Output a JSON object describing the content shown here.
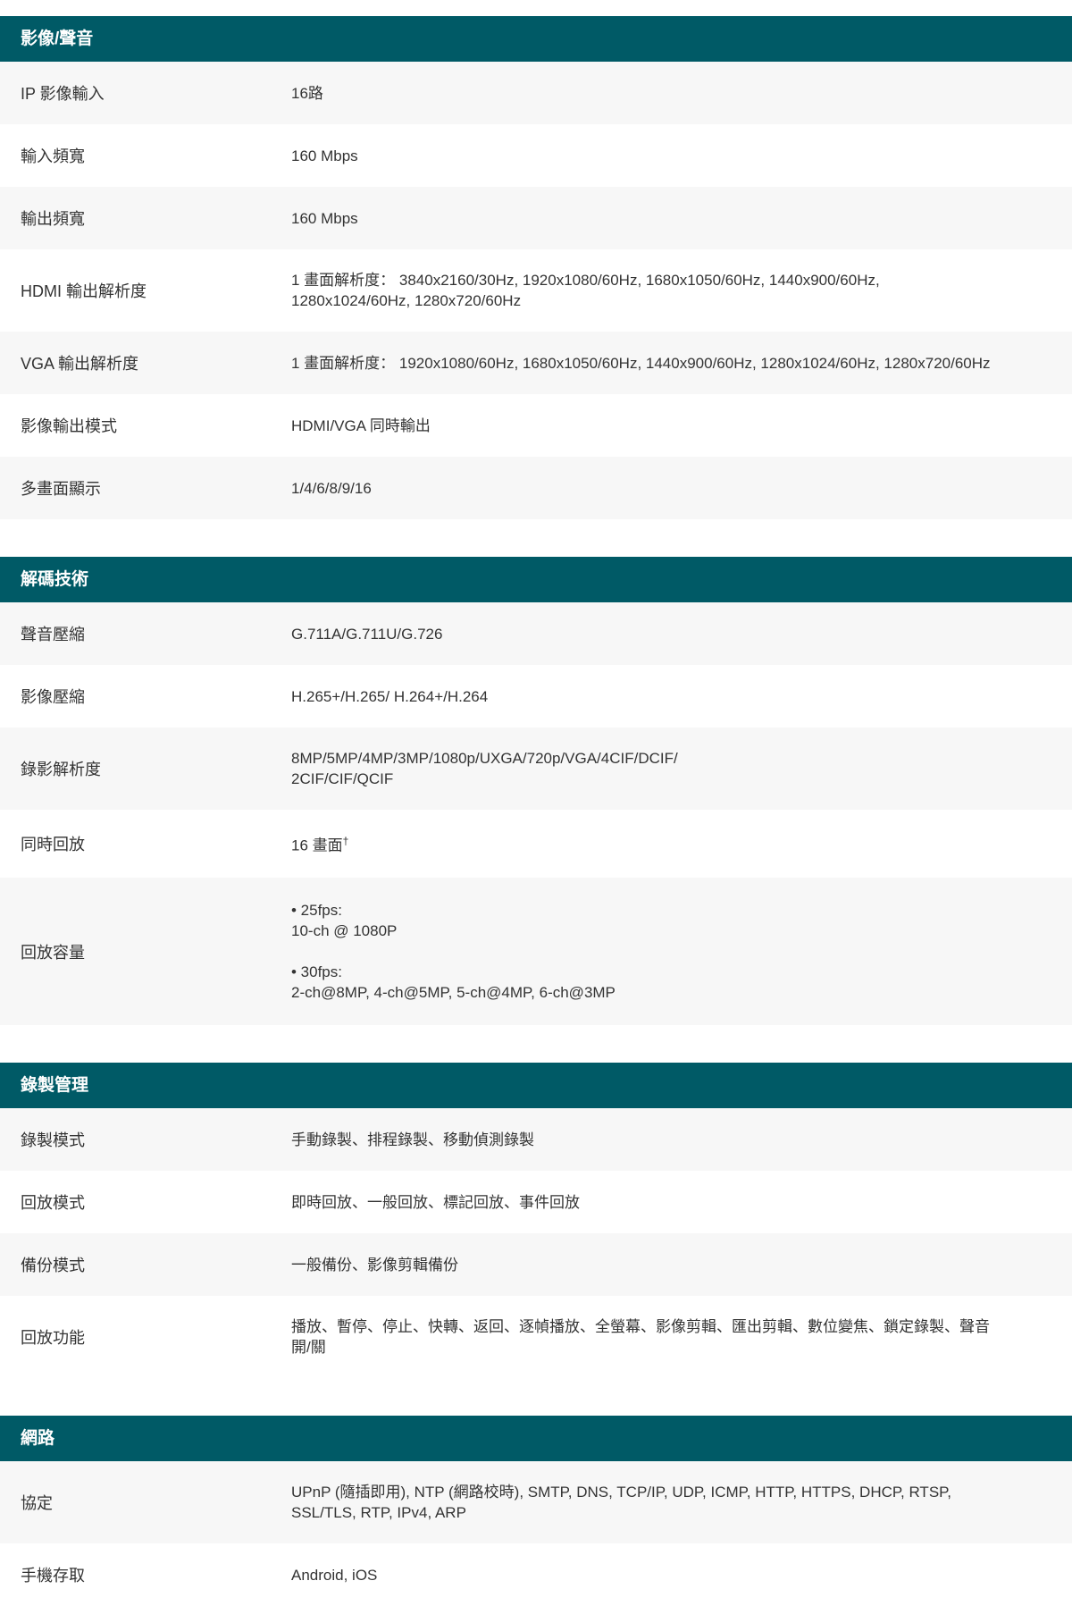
{
  "sections": [
    {
      "title": "影像/聲音",
      "rows": [
        {
          "label": "IP 影像輸入",
          "value": "16路",
          "height": 70
        },
        {
          "label": "輸入頻寬",
          "value": "160 Mbps",
          "height": 70
        },
        {
          "label": "輸出頻寬",
          "value": "160 Mbps",
          "height": 70
        },
        {
          "label": "HDMI 輸出解析度",
          "value": "1 畫面解析度： 3840x2160/30Hz, 1920x1080/60Hz, 1680x1050/60Hz, 1440x900/60Hz,\n1280x1024/60Hz, 1280x720/60Hz",
          "height": 92
        },
        {
          "label": "VGA 輸出解析度",
          "value": "1 畫面解析度： 1920x1080/60Hz, 1680x1050/60Hz, 1440x900/60Hz, 1280x1024/60Hz, 1280x720/60Hz",
          "height": 70
        },
        {
          "label": "影像輸出模式",
          "value": "HDMI/VGA 同時輸出",
          "height": 70
        },
        {
          "label": "多畫面顯示",
          "value": "1/4/6/8/9/16",
          "height": 70
        }
      ]
    },
    {
      "title": "解碼技術",
      "rows": [
        {
          "label": "聲音壓縮",
          "value": "G.711A/G.711U/G.726",
          "height": 70
        },
        {
          "label": "影像壓縮",
          "value": "H.265+/H.265/ H.264+/H.264",
          "height": 70
        },
        {
          "label": "錄影解析度",
          "value": "8MP/5MP/4MP/3MP/1080p/UXGA/720p/VGA/4CIF/DCIF/\n2CIF/CIF/QCIF",
          "height": 92
        },
        {
          "label": "同時回放",
          "value": "16 畫面",
          "sup": "†",
          "height": 76
        },
        {
          "label": "回放容量",
          "value": "• 25fps:\n10-ch @ 1080P\n\n• 30fps:\n2-ch@8MP, 4-ch@5MP, 5-ch@4MP, 6-ch@3MP",
          "height": 165
        }
      ]
    },
    {
      "title": "錄製管理",
      "rows": [
        {
          "label": "錄製模式",
          "value": "手動錄製、排程錄製、移動偵測錄製",
          "height": 70
        },
        {
          "label": "回放模式",
          "value": "即時回放、一般回放、標記回放、事件回放",
          "height": 70
        },
        {
          "label": "備份模式",
          "value": "一般備份、影像剪輯備份",
          "height": 70
        },
        {
          "label": "回放功能",
          "value": "播放、暫停、停止、快轉、返回、逐幀播放、全螢幕、影像剪輯、匯出剪輯、數位變焦、鎖定錄製、聲音\n開/關",
          "height": 92
        }
      ]
    },
    {
      "title": "網路",
      "rows": [
        {
          "label": "協定",
          "value": "UPnP (隨插即用), NTP (網路校時), SMTP, DNS, TCP/IP, UDP, ICMP, HTTP, HTTPS, DHCP, RTSP,\nSSL/TLS, RTP, IPv4, ARP",
          "height": 92
        },
        {
          "label": "手機存取",
          "value": "Android, iOS",
          "height": 70
        }
      ]
    }
  ]
}
